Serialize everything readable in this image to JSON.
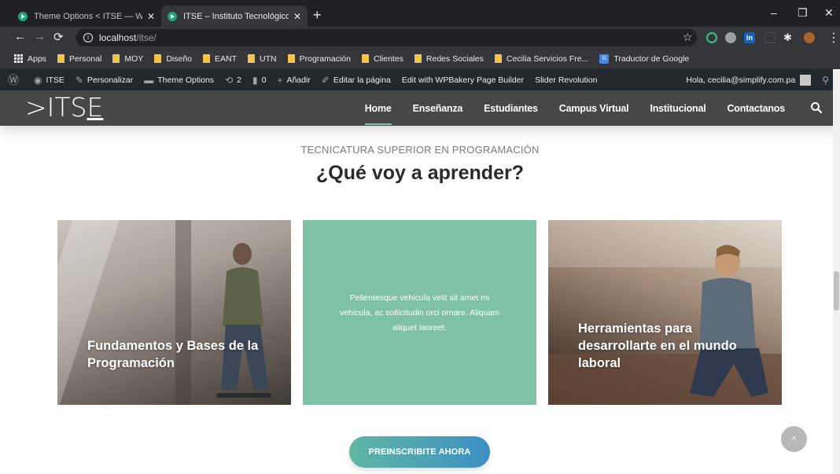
{
  "browser": {
    "tabs": [
      {
        "label": "Theme Options < ITSE — WordPr",
        "active": false
      },
      {
        "label": "ITSE – Instituto Tecnológico de Se",
        "active": true
      }
    ],
    "new_tab_label": "+",
    "address": {
      "host": "localhost",
      "path": "/itse/"
    },
    "window_controls": {
      "minimize": "–",
      "maximize": "❐",
      "close": "✕"
    }
  },
  "bookmarks": [
    {
      "label": "Apps",
      "icon": "apps-grid-icon"
    },
    {
      "label": "Personal",
      "icon": "folder-icon"
    },
    {
      "label": "MOY",
      "icon": "folder-icon"
    },
    {
      "label": "Diseño",
      "icon": "folder-icon"
    },
    {
      "label": "EANT",
      "icon": "folder-icon"
    },
    {
      "label": "UTN",
      "icon": "folder-icon"
    },
    {
      "label": "Programación",
      "icon": "folder-icon"
    },
    {
      "label": "Clientes",
      "icon": "folder-icon"
    },
    {
      "label": "Redes Sociales",
      "icon": "folder-icon"
    },
    {
      "label": "Cecilia Servicios Fre...",
      "icon": "folder-icon"
    },
    {
      "label": "Traductor de Google",
      "icon": "google-translate-icon"
    }
  ],
  "wp_admin_bar": {
    "site_name": "ITSE",
    "customize": "Personalizar",
    "theme_options": "Theme Options",
    "updates_count": "2",
    "comments_count": "0",
    "add_new": "Añadir",
    "edit_page": "Editar la página",
    "wpbakery": "Edit with WPBakery Page Builder",
    "slider": "Slider Revolution",
    "greeting": "Hola, cecilia@simplify.com.pa"
  },
  "site_header": {
    "logo_prefix": ">ITS",
    "logo_suffix": "E",
    "nav": [
      "Home",
      "Enseñanza",
      "Estudiantes",
      "Campus Virtual",
      "Institucional",
      "Contactanos"
    ],
    "active_nav": "Home"
  },
  "section": {
    "eyebrow": "TECNICATURA SUPERIOR EN PROGRAMACIÓN",
    "heading": "¿Qué voy a aprender?"
  },
  "cards": [
    {
      "title": "Fundamentos y Bases de la Programación"
    },
    {
      "desc": "Pellentesque vehicula velit sit amet mi vehicula, ac sollicitudin orci ornare. Aliquam aliquet laoreet."
    },
    {
      "title": "Herramientas para desarrollarte en el mundo laboral"
    }
  ],
  "cta": {
    "label": "PREINSCRIBITE AHORA"
  },
  "colors": {
    "header_bg": "#474747",
    "accent_green": "#7fc1a6",
    "wp_bar": "#23282d",
    "cta_from": "#5fb7a2",
    "cta_to": "#3d8fc4"
  }
}
